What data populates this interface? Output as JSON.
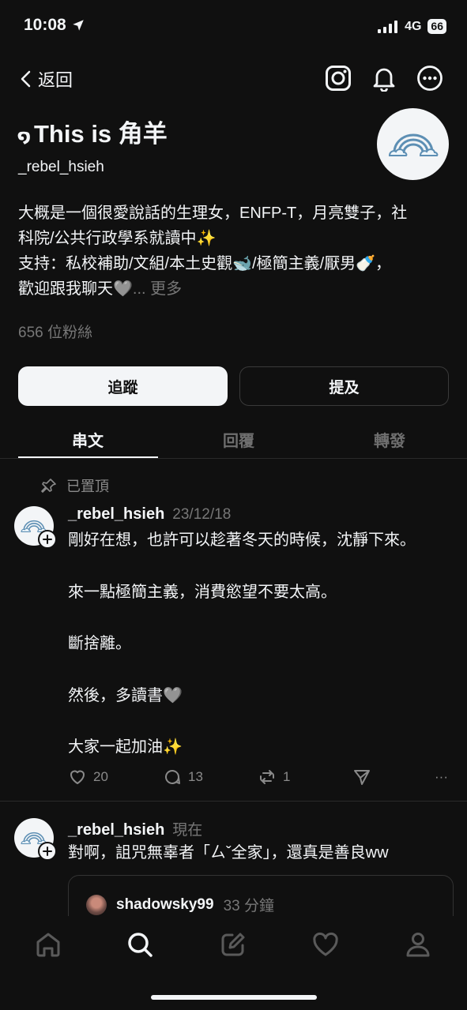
{
  "status_bar": {
    "time": "10:08",
    "network": "4G",
    "battery": "66"
  },
  "nav": {
    "back_label": "返回"
  },
  "profile": {
    "name_prefix": "໑",
    "name": "This is 角羊",
    "handle": "_rebel_hsieh",
    "bio_line1": "大概是一個很愛說話的生理女，ENFP-T，月亮雙子，社",
    "bio_line2": "科院/公共行政學系就讀中✨",
    "bio_line3": "支持：私校補助/文組/本土史觀🐋/極簡主義/厭男🍼，",
    "bio_line4": "歡迎跟我聊天🩶",
    "bio_ellipsis": "...",
    "bio_more": "更多",
    "followers": "656 位粉絲",
    "follow_button": "追蹤",
    "mention_button": "提及"
  },
  "tabs": [
    {
      "label": "串文"
    },
    {
      "label": "回覆"
    },
    {
      "label": "轉發"
    }
  ],
  "pinned_label": "已置頂",
  "posts": [
    {
      "user": "_rebel_hsieh",
      "time": "23/12/18",
      "lines": [
        "剛好在想，也許可以趁著冬天的時候，沈靜下來。",
        "來一點極簡主義，消費慾望不要太高。",
        "斷捨離。",
        "然後，多讀書🩶",
        "大家一起加油✨"
      ],
      "likes": "20",
      "comments": "13",
      "reposts": "1",
      "more": "···"
    },
    {
      "user": "_rebel_hsieh",
      "time": "現在",
      "text": "對啊，詛咒無辜者「ㄙˇ全家」，還真是善良ww",
      "quote_user": "shadowsky99",
      "quote_time": "33 分鐘"
    }
  ],
  "colors": {
    "background": "#101010",
    "text": "#f3f5f7",
    "muted": "#777777",
    "divider": "#2a2a2a",
    "rainbow_logo": "#5d8fb4"
  }
}
